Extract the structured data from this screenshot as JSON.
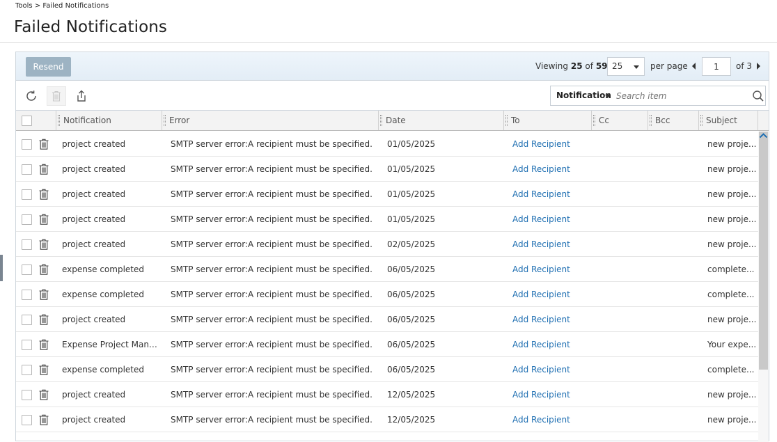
{
  "breadcrumb": "Tools > Failed Notifications",
  "page_title": "Failed Notifications",
  "toolbar": {
    "resend_label": "Resend",
    "viewing_prefix": "Viewing",
    "viewing_count": "25",
    "viewing_of": "of",
    "viewing_total": "59",
    "per_page_value": "25",
    "per_page_label": "per page",
    "current_page": "1",
    "of_pages": "of 3"
  },
  "search": {
    "filter_label": "Notification",
    "placeholder": "Search item"
  },
  "icons": {
    "refresh": "refresh-icon",
    "delete": "trash-icon",
    "export": "export-icon",
    "search": "search-icon"
  },
  "colors": {
    "link": "#1f6fb2",
    "resend_button": "#9db3c3",
    "header_bg": "#e9f1f8"
  },
  "columns": [
    "Notification",
    "Error",
    "Date",
    "To",
    "Cc",
    "Bcc",
    "Subject"
  ],
  "rows": [
    {
      "notification": "project created",
      "error": "SMTP server error:A recipient must be specified.",
      "date": "01/05/2025",
      "to": "Add Recipient",
      "cc": "",
      "bcc": "",
      "subject": "new proje..."
    },
    {
      "notification": "project created",
      "error": "SMTP server error:A recipient must be specified.",
      "date": "01/05/2025",
      "to": "Add Recipient",
      "cc": "",
      "bcc": "",
      "subject": "new proje..."
    },
    {
      "notification": "project created",
      "error": "SMTP server error:A recipient must be specified.",
      "date": "01/05/2025",
      "to": "Add Recipient",
      "cc": "",
      "bcc": "",
      "subject": "new proje..."
    },
    {
      "notification": "project created",
      "error": "SMTP server error:A recipient must be specified.",
      "date": "01/05/2025",
      "to": "Add Recipient",
      "cc": "",
      "bcc": "",
      "subject": "new proje..."
    },
    {
      "notification": "project created",
      "error": "SMTP server error:A recipient must be specified.",
      "date": "02/05/2025",
      "to": "Add Recipient",
      "cc": "",
      "bcc": "",
      "subject": "new proje..."
    },
    {
      "notification": "expense completed",
      "error": "SMTP server error:A recipient must be specified.",
      "date": "06/05/2025",
      "to": "Add Recipient",
      "cc": "",
      "bcc": "",
      "subject": "complete..."
    },
    {
      "notification": "expense completed",
      "error": "SMTP server error:A recipient must be specified.",
      "date": "06/05/2025",
      "to": "Add Recipient",
      "cc": "",
      "bcc": "",
      "subject": "complete..."
    },
    {
      "notification": "project created",
      "error": "SMTP server error:A recipient must be specified.",
      "date": "06/05/2025",
      "to": "Add Recipient",
      "cc": "",
      "bcc": "",
      "subject": "new proje..."
    },
    {
      "notification": "Expense Project Mana...",
      "error": "SMTP server error:A recipient must be specified.",
      "date": "06/05/2025",
      "to": "Add Recipient",
      "cc": "",
      "bcc": "",
      "subject": "Your expe..."
    },
    {
      "notification": "expense completed",
      "error": "SMTP server error:A recipient must be specified.",
      "date": "06/05/2025",
      "to": "Add Recipient",
      "cc": "",
      "bcc": "",
      "subject": "complete..."
    },
    {
      "notification": "project created",
      "error": "SMTP server error:A recipient must be specified.",
      "date": "12/05/2025",
      "to": "Add Recipient",
      "cc": "",
      "bcc": "",
      "subject": "new proje..."
    },
    {
      "notification": "project created",
      "error": "SMTP server error:A recipient must be specified.",
      "date": "12/05/2025",
      "to": "Add Recipient",
      "cc": "",
      "bcc": "",
      "subject": "new proje..."
    }
  ]
}
